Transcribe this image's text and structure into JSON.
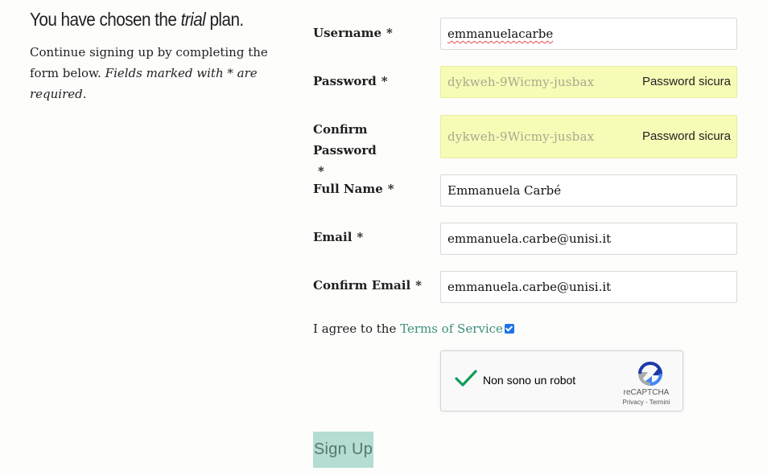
{
  "intro": {
    "heading_prefix": "You have chosen the",
    "plan_name": "trial",
    "heading_suffix": "plan.",
    "text_plain": "Continue signing up by completing the form below.",
    "text_italic": "Fields marked with * are required."
  },
  "form": {
    "required_marker": "*",
    "username": {
      "label": "Username",
      "value": "emmanuelacarbe"
    },
    "password": {
      "label": "Password",
      "value": "dykweh-9Wicmy-jusbax",
      "hint": "Password sicura"
    },
    "confirm_password": {
      "label": "Confirm Password",
      "value": "dykweh-9Wicmy-jusbax",
      "hint": "Password sicura"
    },
    "full_name": {
      "label": "Full Name",
      "value": "Emmanuela Carbé"
    },
    "email": {
      "label": "Email",
      "value": "emmanuela.carbe@unisi.it"
    },
    "confirm_email": {
      "label": "Confirm Email",
      "value": "emmanuela.carbe@unisi.it"
    },
    "tos": {
      "prefix": "I agree to the",
      "link": "Terms of Service",
      "checked": true
    },
    "captcha": {
      "label": "Non sono un robot",
      "brand": "reCAPTCHA",
      "links": "Privacy - Termini"
    },
    "submit_label": "Sign Up"
  },
  "colors": {
    "autofill_bg": "#f6fbb6",
    "link": "#3f8f7c",
    "button_bg": "#b5ddd2",
    "checkbox": "#1a73e8",
    "captcha_check": "#0f9d58"
  }
}
